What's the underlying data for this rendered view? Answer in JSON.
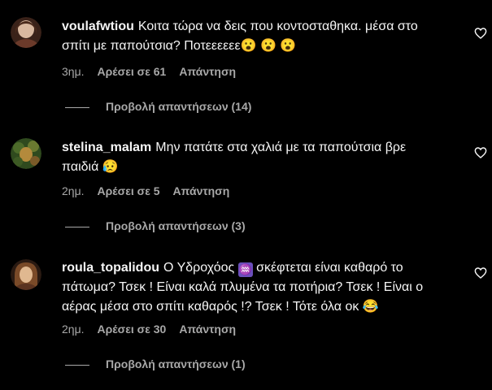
{
  "comments": [
    {
      "username": "voulafwtiou",
      "text": "Κοιτα τώρα να δεις που κοντοσταθηκα. μέσα στο σπίτι με παπούτσια? Ποτεεεεεε",
      "emojis": "😮 😮 😮",
      "time": "3ημ.",
      "likes": "Αρέσει σε 61",
      "reply": "Απάντηση",
      "view_replies": "Προβολή απαντήσεων (14)",
      "avatar_colors": [
        "#6b3a2a",
        "#d9b9a0"
      ]
    },
    {
      "username": "stelina_malam",
      "text": "Μην πατάτε στα χαλιά με τα παπούτσια βρε παιδιά",
      "emojis": "😥",
      "time": "2ημ.",
      "likes": "Αρέσει σε 5",
      "reply": "Απάντηση",
      "view_replies": "Προβολή απαντήσεων (3)",
      "avatar_colors": [
        "#2f4a1e",
        "#b48a3c"
      ]
    },
    {
      "username": "roula_topalidou",
      "text_before": "Ο Υδροχόος",
      "symbol": "♒",
      "text_after": "σκέφτεται είναι καθαρό το πάτωμα? Τσεκ ! Είναι καλά πλυμένα τα ποτήρια? Τσεκ ! Είναι ο αέρας μέσα στο σπίτι καθαρός !? Τσεκ ! Τότε όλα οκ",
      "emojis": "😂",
      "time": "2ημ.",
      "likes": "Αρέσει σε 30",
      "reply": "Απάντηση",
      "view_replies": "Προβολή απαντήσεων (1)",
      "avatar_colors": [
        "#5a3320",
        "#e0b890"
      ]
    }
  ],
  "colors": {
    "background": "#000000",
    "text": "#f5f5f5",
    "muted": "#a8a8a8"
  },
  "icons": {
    "like": "heart-outline-icon"
  }
}
